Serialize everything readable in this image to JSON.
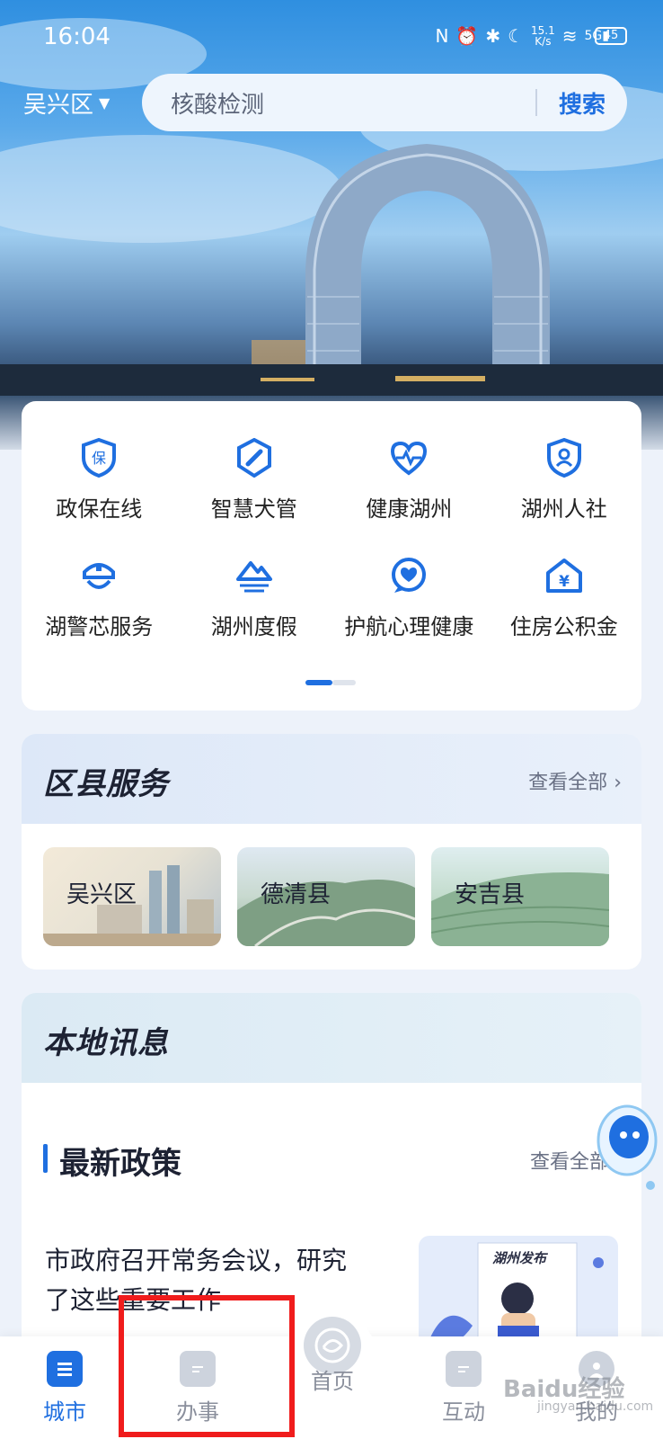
{
  "status_bar": {
    "time": "16:04",
    "speed_top": "15.1",
    "speed_unit": "K/s",
    "network": "5G",
    "battery": "45"
  },
  "header": {
    "region": "吴兴区",
    "search_placeholder": "核酸检测",
    "search_button": "搜索"
  },
  "quick_services": {
    "items": [
      {
        "label": "政保在线",
        "icon": "insurance-shield-icon"
      },
      {
        "label": "智慧犬管",
        "icon": "bone-shield-icon"
      },
      {
        "label": "健康湖州",
        "icon": "heart-pulse-icon"
      },
      {
        "label": "湖州人社",
        "icon": "person-shield-icon"
      },
      {
        "label": "湖警芯服务",
        "icon": "police-cap-icon"
      },
      {
        "label": "湖州度假",
        "icon": "mountain-water-icon"
      },
      {
        "label": "护航心理健康",
        "icon": "heart-chat-icon"
      },
      {
        "label": "住房公积金",
        "icon": "yuan-house-icon"
      }
    ]
  },
  "district_services": {
    "title": "区县服务",
    "more": "查看全部",
    "districts": [
      "吴兴区",
      "德清县",
      "安吉县"
    ]
  },
  "local_news": {
    "title": "本地讯息",
    "policy_title": "最新政策",
    "policy_more": "查看全部",
    "article_title": "市政府召开常务会议，研究了这些重要工作",
    "thumb_caption": "湖州发布"
  },
  "bottom_nav": {
    "items": [
      {
        "label": "城市",
        "active": true
      },
      {
        "label": "办事",
        "active": false
      },
      {
        "label": "首页",
        "active": false
      },
      {
        "label": "互动",
        "active": false
      },
      {
        "label": "我的",
        "active": false
      }
    ]
  },
  "watermark": {
    "text": "Baidu经验",
    "sub": "jingyan.baidu.com"
  },
  "colors": {
    "accent": "#1f6fe0",
    "highlight": "#f01c1c"
  }
}
